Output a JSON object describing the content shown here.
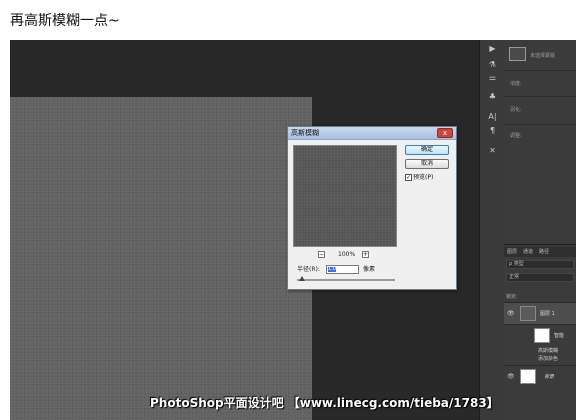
{
  "caption": "再高斯模糊一点~",
  "dialog": {
    "title": "高斯模糊",
    "close_label": "x",
    "ok_label": "确定",
    "cancel_label": "取消",
    "preview_label": "预览(P)",
    "preview_checked_mark": "✓",
    "zoom_out": "−",
    "zoom_in": "+",
    "zoom_value": "100%",
    "radius_label": "半径(R):",
    "radius_value": "1.0",
    "radius_unit": "像素"
  },
  "tools": {
    "icons": [
      "play-icon",
      "brush-preset-icon",
      "adjust-icon",
      "clone-source-icon",
      "character-icon",
      "paragraph-icon",
      "tools-icon"
    ],
    "glyphs": [
      "▶",
      "⚗",
      "⚌",
      "♣",
      "A|",
      "¶",
      "✕"
    ]
  },
  "properties": {
    "mask_caption": "未选择蒙版",
    "density_label": "浓度:",
    "feather_label": "羽化:",
    "adjust_label": "调整:"
  },
  "layers_panel": {
    "tabs": [
      "图层",
      "通道",
      "路径"
    ],
    "filter_label": "ρ 类型",
    "blend_mode": "正常",
    "lock_label": "锁定:",
    "layers": [
      {
        "name": "图层 1",
        "active": true
      },
      {
        "name": "智能",
        "active": false
      },
      {
        "name": "背景",
        "active": false
      }
    ],
    "effects": [
      "高斯模糊",
      "添加杂色"
    ]
  },
  "colors": {
    "canvas": "#626262",
    "workspace": "#282828",
    "panel": "#3b3b3b"
  },
  "watermark": "PhotoShop平面设计吧 【www.linecg.com/tieba/1783】"
}
